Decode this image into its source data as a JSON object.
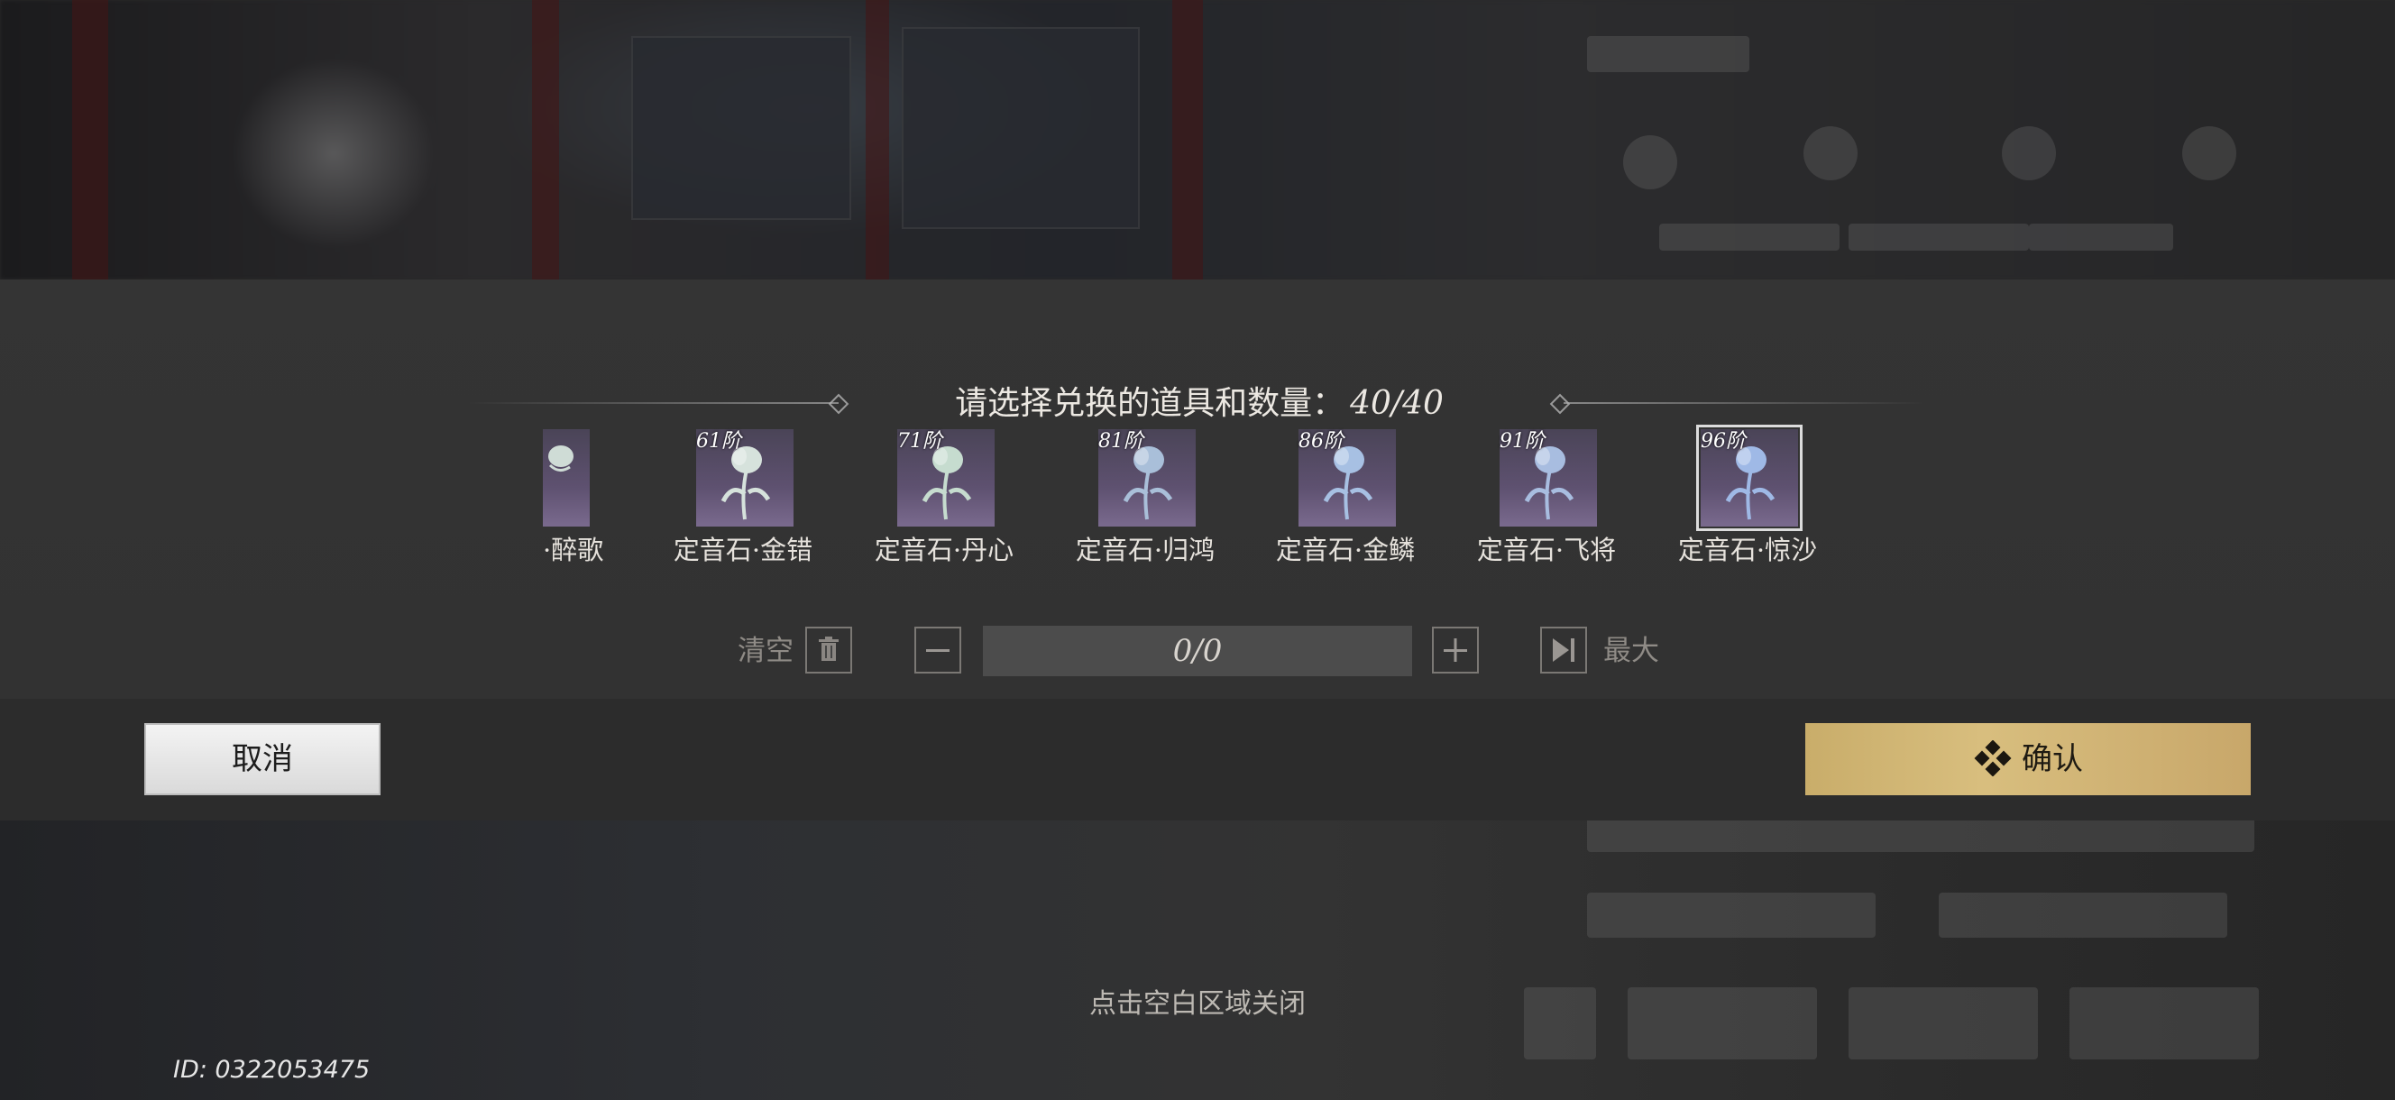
{
  "dialog": {
    "title_prefix": "请选择兑换的道具和数量：",
    "title_count": "40/40"
  },
  "items": [
    {
      "tier": "",
      "name": "·醉歌",
      "selected": false
    },
    {
      "tier": "61阶",
      "name": "定音石·金错",
      "selected": false
    },
    {
      "tier": "71阶",
      "name": "定音石·丹心",
      "selected": false
    },
    {
      "tier": "81阶",
      "name": "定音石·归鸿",
      "selected": false
    },
    {
      "tier": "86阶",
      "name": "定音石·金鳞",
      "selected": false
    },
    {
      "tier": "91阶",
      "name": "定音石·飞将",
      "selected": false
    },
    {
      "tier": "96阶",
      "name": "定音石·惊沙",
      "selected": true
    }
  ],
  "quantity": {
    "clear_label": "清空",
    "value": "0/0",
    "max_label": "最大"
  },
  "buttons": {
    "cancel": "取消",
    "confirm": "确认"
  },
  "footer": {
    "hint": "点击空白区域关闭",
    "uid": "ID: 0322053475"
  },
  "colors": {
    "confirm_gold": "#d2b878",
    "cancel_white": "#e8e8e8",
    "panel_gray": "#333333"
  },
  "icons": [
    "trash-icon",
    "minus-icon",
    "plus-icon",
    "skip-to-end-icon",
    "diamond-icon"
  ]
}
